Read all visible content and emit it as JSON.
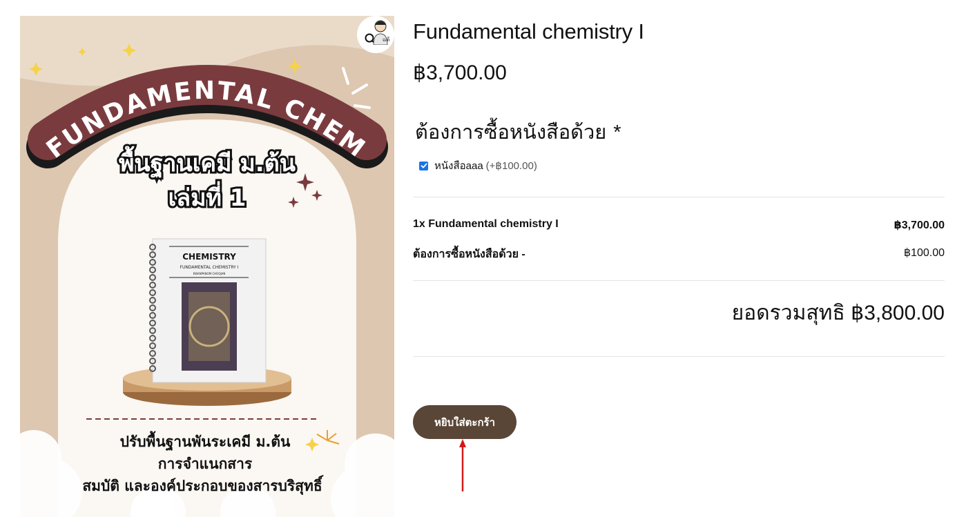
{
  "product": {
    "title": "Fundamental chemistry I",
    "price": "฿3,700.00"
  },
  "image": {
    "arc_text": "FUNDAMENTAL CHEM",
    "thai_title_line1": "พื้นฐานเคมี ม.ต้น",
    "thai_title_line2": "เล่มที่ 1",
    "book_title": "CHEMISTRY",
    "book_subtitle": "FUNDAMENTAL CHEMISTRY I",
    "book_author": "KWANPANOM CHOOJAN",
    "topics": [
      "ปรับพื้นฐานพันระเคมี ม.ต้น",
      "การจำแนกสาร",
      "สมบัติ และองค์ประกอบของสารบริสุทธิ์"
    ],
    "avatar_label": "แต้"
  },
  "addon": {
    "label": "ต้องการซื้อหนังสือด้วย",
    "required_mark": "*",
    "option_label": "หนังสือaaa",
    "option_price": "(+฿100.00)",
    "checked": true
  },
  "summary": {
    "rows": [
      {
        "label": "1x Fundamental chemistry I",
        "value": "฿3,700.00"
      },
      {
        "label": "ต้องการซื้อหนังสือด้วย -",
        "value": "฿100.00"
      }
    ],
    "total_label": "ยอดรวมสุทธิ",
    "total_value": "฿3,800.00"
  },
  "add_to_cart": "หยิบใส่ตะกร้า",
  "colors": {
    "button": "#5a4636",
    "arrow": "#d11a1a",
    "checkbox": "#1a73e8",
    "image_bg": "#ddc7b0",
    "banner": "#7a3b3f"
  }
}
